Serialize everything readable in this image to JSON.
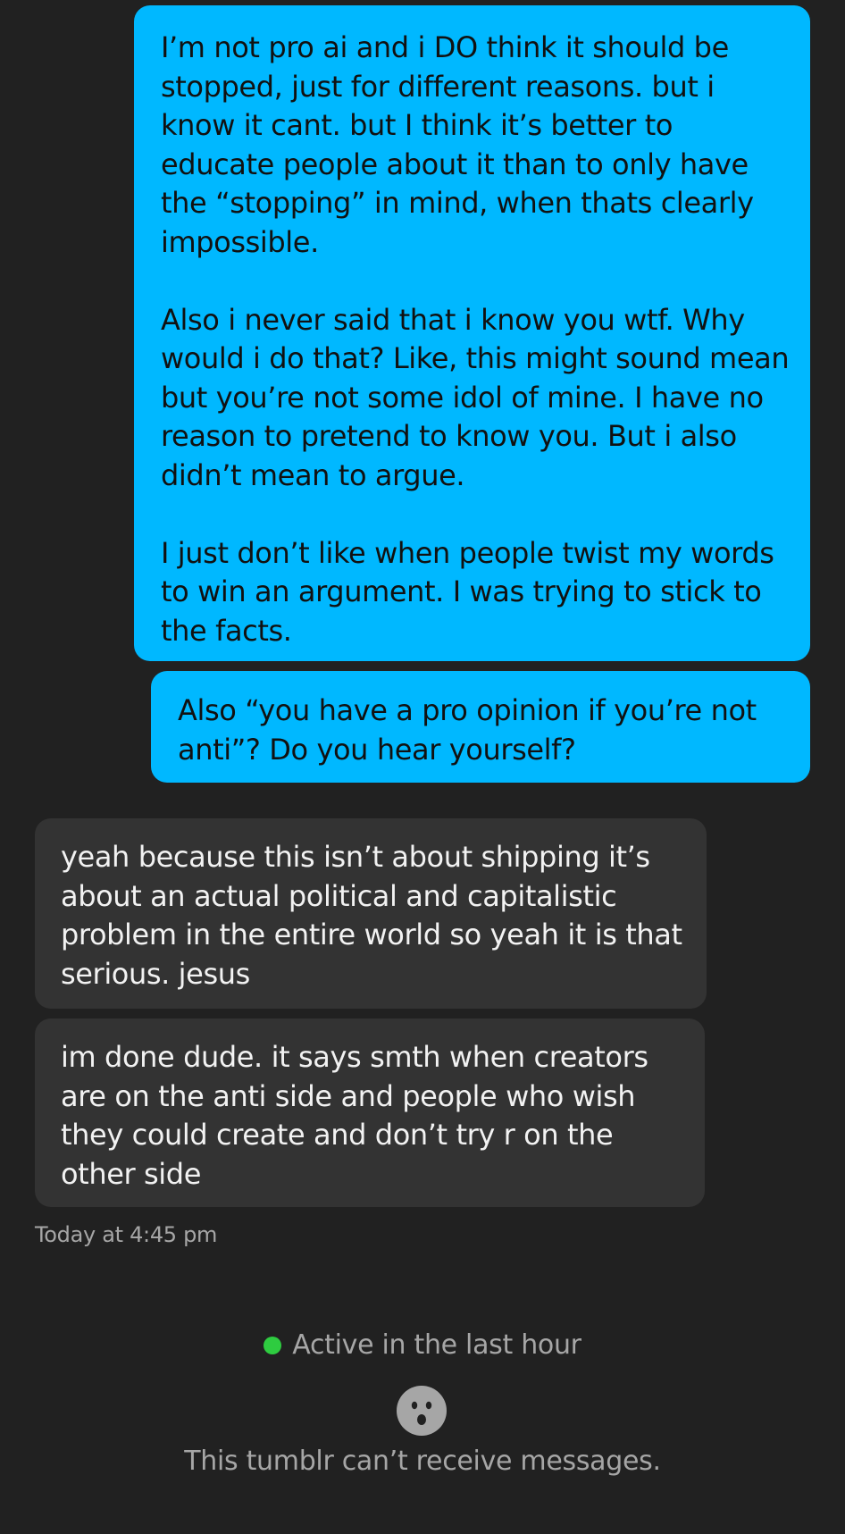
{
  "messages": [
    {
      "id": "msg-1",
      "direction": "sent",
      "text": "I’m not pro ai and i DO think it should be stopped, just for different reasons. but i know it cant. but I think it’s better to educate people about it than to only have the “stopping” in mind, when thats clearly impossible.\n\nAlso i never said that i know you wtf. Why would i do that? Like, this might sound mean but you’re not some idol of mine. I have no reason to pretend to know you. But i also didn’t mean to argue.\n\nI just don’t like when people twist my words to win an argument. I was trying to stick to the facts."
    },
    {
      "id": "msg-2",
      "direction": "sent",
      "text": "Also “you have a pro opinion if you’re not anti”? Do you hear yourself?"
    },
    {
      "id": "msg-3",
      "direction": "received",
      "text": "yeah because this isn’t about shipping it’s about an actual political and capitalistic problem in the entire world so yeah it is that serious. jesus"
    },
    {
      "id": "msg-4",
      "direction": "received",
      "text": "im done dude. it says smth when creators are on the anti side and people who wish they could create and don’t try r on the other side"
    }
  ],
  "timestamp": "Today at 4:45 pm",
  "status": {
    "active_text": "Active in the last hour",
    "dot_color": "#2ecc40"
  },
  "notice": {
    "icon": "sad-face-icon",
    "text": "This tumblr can’t receive messages."
  },
  "colors": {
    "background": "#212121",
    "sent_bubble": "#00b8ff",
    "received_bubble": "#333333"
  }
}
